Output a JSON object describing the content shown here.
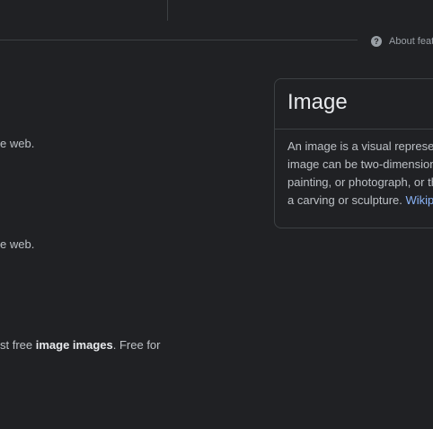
{
  "header": {
    "about_label": "About feat"
  },
  "results": [
    {
      "snippet": "e web."
    },
    {
      "snippet": "e web."
    },
    {
      "snippet_pre": "st free ",
      "snippet_bold": "image images",
      "snippet_post": ". Free for"
    }
  ],
  "knowledge_panel": {
    "title": "Image",
    "lines": [
      "An image is a visual represen",
      "image can be two-dimensiona",
      "painting, or photograph, or th"
    ],
    "last_line_text": "a carving or sculpture. ",
    "source_link": "Wikipe"
  },
  "colors": {
    "background": "#202124",
    "link": "#8ab4f8",
    "divider": "#3c4043"
  }
}
